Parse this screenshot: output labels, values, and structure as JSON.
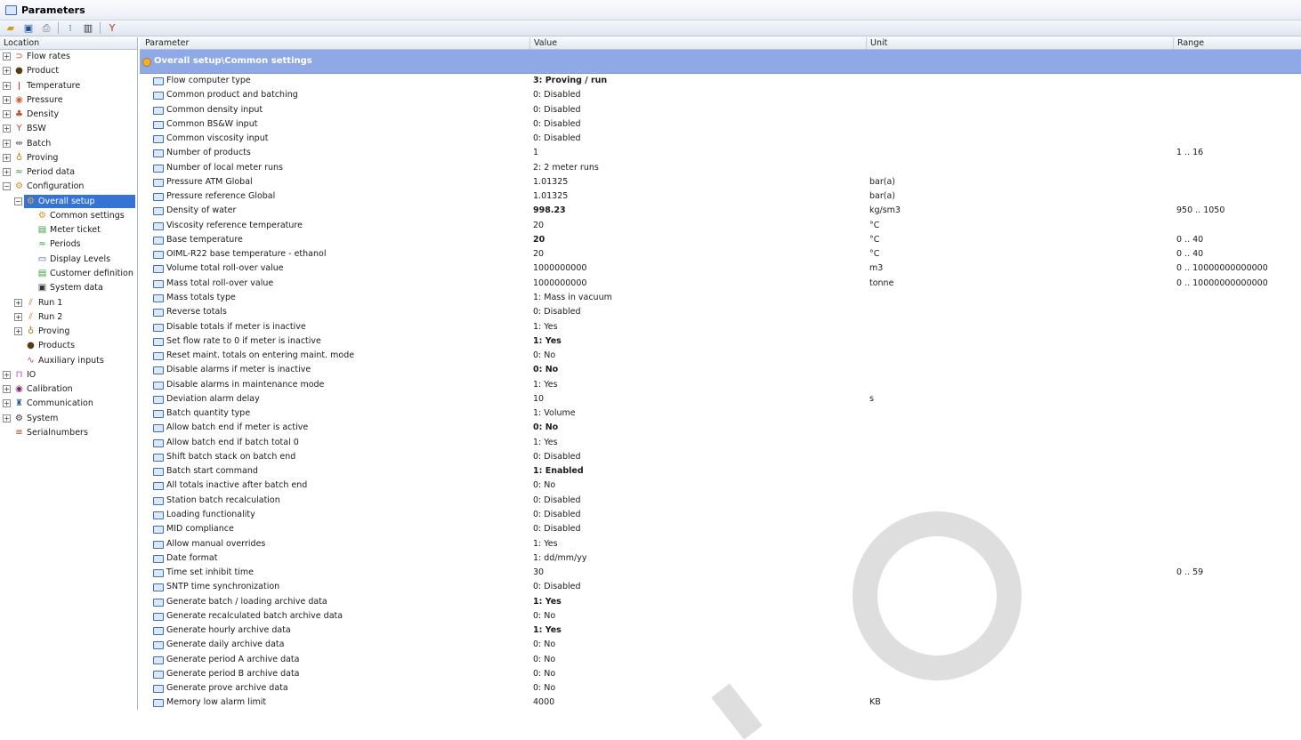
{
  "window": {
    "title": "Parameters"
  },
  "toolbar": {
    "buttons": [
      "open-icon",
      "save-icon",
      "print-icon",
      "tree-view-icon",
      "grid-view-icon",
      "filter-icon"
    ]
  },
  "tree": {
    "header": "Location",
    "items": [
      {
        "label": "Flow rates",
        "level": 0,
        "exp": "+",
        "icon": "flow-rates-icon",
        "glyph": "⊃",
        "color": "#c04020"
      },
      {
        "label": "Product",
        "level": 0,
        "exp": "+",
        "icon": "product-drop-icon",
        "glyph": "●",
        "color": "#5a3a10"
      },
      {
        "label": "Temperature",
        "level": 0,
        "exp": "+",
        "icon": "thermometer-icon",
        "glyph": "ǀ",
        "color": "#c03020"
      },
      {
        "label": "Pressure",
        "level": 0,
        "exp": "+",
        "icon": "pressure-gauge-icon",
        "glyph": "◉",
        "color": "#d06040"
      },
      {
        "label": "Density",
        "level": 0,
        "exp": "+",
        "icon": "density-icon",
        "glyph": "♣",
        "color": "#c05030"
      },
      {
        "label": "BSW",
        "level": 0,
        "exp": "+",
        "icon": "bsw-funnel-icon",
        "glyph": "Y",
        "color": "#b04030"
      },
      {
        "label": "Batch",
        "level": 0,
        "exp": "+",
        "icon": "batch-icon",
        "glyph": "⇹",
        "color": "#6a6a6a"
      },
      {
        "label": "Proving",
        "level": 0,
        "exp": "+",
        "icon": "proving-medal-icon",
        "glyph": "♁",
        "color": "#c08010"
      },
      {
        "label": "Period data",
        "level": 0,
        "exp": "+",
        "icon": "period-data-icon",
        "glyph": "≈",
        "color": "#3a9a3a"
      },
      {
        "label": "Configuration",
        "level": 0,
        "exp": "−",
        "icon": "configuration-gear-icon",
        "glyph": "⚙",
        "color": "#d09020"
      },
      {
        "label": "Overall setup",
        "level": 1,
        "exp": "−",
        "icon": "overall-setup-icon",
        "glyph": "⚙",
        "color": "#f0b030",
        "selected": true
      },
      {
        "label": "Common settings",
        "level": 2,
        "exp": "",
        "icon": "common-settings-icon",
        "glyph": "⚙",
        "color": "#d09020"
      },
      {
        "label": "Meter ticket",
        "level": 2,
        "exp": "",
        "icon": "meter-ticket-icon",
        "glyph": "▤",
        "color": "#3a9a3a"
      },
      {
        "label": "Periods",
        "level": 2,
        "exp": "",
        "icon": "periods-icon",
        "glyph": "≈",
        "color": "#3a9a3a"
      },
      {
        "label": "Display Levels",
        "level": 2,
        "exp": "",
        "icon": "display-levels-icon",
        "glyph": "▭",
        "color": "#2a5aa0"
      },
      {
        "label": "Customer definition",
        "level": 2,
        "exp": "",
        "icon": "customer-definition-icon",
        "glyph": "▤",
        "color": "#3a9a3a"
      },
      {
        "label": "System data",
        "level": 2,
        "exp": "",
        "icon": "system-data-icon",
        "glyph": "▣",
        "color": "#333"
      },
      {
        "label": "Run 1",
        "level": 1,
        "exp": "+",
        "icon": "run-icon",
        "glyph": "⫽",
        "color": "#c08010"
      },
      {
        "label": "Run 2",
        "level": 1,
        "exp": "+",
        "icon": "run-icon",
        "glyph": "⫽",
        "color": "#c08010"
      },
      {
        "label": "Proving",
        "level": 1,
        "exp": "+",
        "icon": "proving-medal-icon",
        "glyph": "♁",
        "color": "#c08010"
      },
      {
        "label": "Products",
        "level": 1,
        "exp": "",
        "icon": "product-drop-icon",
        "glyph": "●",
        "color": "#5a3a10"
      },
      {
        "label": "Auxiliary inputs",
        "level": 1,
        "exp": "",
        "icon": "auxiliary-inputs-icon",
        "glyph": "∿",
        "color": "#b040b0"
      },
      {
        "label": "IO",
        "level": 0,
        "exp": "+",
        "icon": "io-signal-icon",
        "glyph": "⊓",
        "color": "#b040b0"
      },
      {
        "label": "Calibration",
        "level": 0,
        "exp": "+",
        "icon": "calibration-icon",
        "glyph": "◉",
        "color": "#7a2a6a"
      },
      {
        "label": "Communication",
        "level": 0,
        "exp": "+",
        "icon": "communication-icon",
        "glyph": "♜",
        "color": "#2a5aa0"
      },
      {
        "label": "System",
        "level": 0,
        "exp": "+",
        "icon": "system-gear-icon",
        "glyph": "⚙",
        "color": "#333"
      },
      {
        "label": "Serialnumbers",
        "level": 0,
        "exp": "",
        "icon": "serialnumbers-icon",
        "glyph": "≡",
        "color": "#c03020"
      }
    ]
  },
  "grid": {
    "headers": {
      "parameter": "Parameter",
      "value": "Value",
      "unit": "Unit",
      "range": "Range"
    },
    "group_title": "Overall setup\\Common settings",
    "rows": [
      {
        "name": "Flow computer type",
        "value": "3: Proving / run",
        "unit": "",
        "range": "",
        "bold": true
      },
      {
        "name": "Common product and batching",
        "value": "0: Disabled",
        "unit": "",
        "range": ""
      },
      {
        "name": "Common density input",
        "value": "0: Disabled",
        "unit": "",
        "range": ""
      },
      {
        "name": "Common BS&W input",
        "value": "0: Disabled",
        "unit": "",
        "range": ""
      },
      {
        "name": "Common viscosity input",
        "value": "0: Disabled",
        "unit": "",
        "range": ""
      },
      {
        "name": "Number of products",
        "value": "1",
        "unit": "",
        "range": "1 .. 16"
      },
      {
        "name": "Number of local meter runs",
        "value": "2: 2 meter runs",
        "unit": "",
        "range": ""
      },
      {
        "name": "Pressure ATM Global",
        "value": "1.01325",
        "unit": "bar(a)",
        "range": ""
      },
      {
        "name": "Pressure reference Global",
        "value": "1.01325",
        "unit": "bar(a)",
        "range": ""
      },
      {
        "name": "Density of water",
        "value": "998.23",
        "unit": "kg/sm3",
        "range": "950 .. 1050",
        "bold": true
      },
      {
        "name": "Viscosity reference temperature",
        "value": "20",
        "unit": "°C",
        "range": ""
      },
      {
        "name": "Base temperature",
        "value": "20",
        "unit": "°C",
        "range": "0 .. 40",
        "bold": true
      },
      {
        "name": "OIML-R22 base temperature - ethanol",
        "value": "20",
        "unit": "°C",
        "range": "0 .. 40"
      },
      {
        "name": "Volume total roll-over value",
        "value": "1000000000",
        "unit": "m3",
        "range": "0 .. 10000000000000"
      },
      {
        "name": "Mass total roll-over value",
        "value": "1000000000",
        "unit": "tonne",
        "range": "0 .. 10000000000000"
      },
      {
        "name": "Mass totals type",
        "value": "1: Mass in vacuum",
        "unit": "",
        "range": ""
      },
      {
        "name": "Reverse totals",
        "value": "0: Disabled",
        "unit": "",
        "range": ""
      },
      {
        "name": "Disable totals if meter is inactive",
        "value": "1: Yes",
        "unit": "",
        "range": ""
      },
      {
        "name": "Set flow rate to 0 if meter is inactive",
        "value": "1: Yes",
        "unit": "",
        "range": "",
        "bold": true
      },
      {
        "name": "Reset maint. totals on entering maint. mode",
        "value": "0: No",
        "unit": "",
        "range": ""
      },
      {
        "name": "Disable alarms if meter is inactive",
        "value": "0: No",
        "unit": "",
        "range": "",
        "bold": true
      },
      {
        "name": "Disable alarms in maintenance mode",
        "value": "1: Yes",
        "unit": "",
        "range": ""
      },
      {
        "name": "Deviation alarm delay",
        "value": "10",
        "unit": "s",
        "range": ""
      },
      {
        "name": "Batch quantity type",
        "value": "1: Volume",
        "unit": "",
        "range": ""
      },
      {
        "name": "Allow batch end if meter is active",
        "value": "0: No",
        "unit": "",
        "range": "",
        "bold": true
      },
      {
        "name": "Allow batch end if batch total 0",
        "value": "1: Yes",
        "unit": "",
        "range": ""
      },
      {
        "name": "Shift batch stack on batch end",
        "value": "0: Disabled",
        "unit": "",
        "range": ""
      },
      {
        "name": "Batch start command",
        "value": "1: Enabled",
        "unit": "",
        "range": "",
        "bold": true
      },
      {
        "name": "All totals inactive after batch end",
        "value": "0: No",
        "unit": "",
        "range": ""
      },
      {
        "name": "Station batch recalculation",
        "value": "0: Disabled",
        "unit": "",
        "range": ""
      },
      {
        "name": "Loading functionality",
        "value": "0: Disabled",
        "unit": "",
        "range": ""
      },
      {
        "name": "MID compliance",
        "value": "0: Disabled",
        "unit": "",
        "range": ""
      },
      {
        "name": "Allow manual overrides",
        "value": "1: Yes",
        "unit": "",
        "range": ""
      },
      {
        "name": "Date format",
        "value": "1: dd/mm/yy",
        "unit": "",
        "range": ""
      },
      {
        "name": "Time set inhibit time",
        "value": "30",
        "unit": "s",
        "range": "0 .. 59"
      },
      {
        "name": "SNTP time synchronization",
        "value": "0: Disabled",
        "unit": "",
        "range": ""
      },
      {
        "name": "Generate batch / loading archive data",
        "value": "1: Yes",
        "unit": "",
        "range": "",
        "bold": true
      },
      {
        "name": "Generate recalculated batch archive data",
        "value": "0: No",
        "unit": "",
        "range": ""
      },
      {
        "name": "Generate hourly archive data",
        "value": "1: Yes",
        "unit": "",
        "range": "",
        "bold": true
      },
      {
        "name": "Generate daily archive data",
        "value": "0: No",
        "unit": "",
        "range": ""
      },
      {
        "name": "Generate period A archive data",
        "value": "0: No",
        "unit": "",
        "range": ""
      },
      {
        "name": "Generate period B archive data",
        "value": "0: No",
        "unit": "",
        "range": ""
      },
      {
        "name": "Generate prove archive data",
        "value": "0: No",
        "unit": "",
        "range": ""
      },
      {
        "name": "Memory low alarm limit",
        "value": "4000",
        "unit": "KB",
        "range": ""
      }
    ]
  }
}
